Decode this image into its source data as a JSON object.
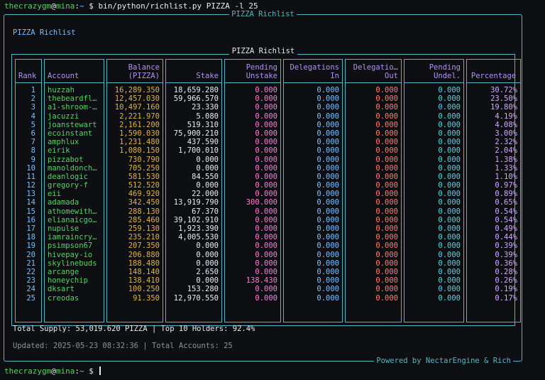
{
  "terminal": {
    "top_prompt": {
      "user": "thecrazygm",
      "host": "mina",
      "path": "~",
      "command": "bin/python/richlist.py PIZZA -l 25"
    },
    "bottom_prompt": {
      "user": "thecrazygm",
      "host": "mina",
      "path": "~"
    }
  },
  "panel": {
    "title": "PIZZA Richlist",
    "heading": "PIZZA Richlist",
    "footer": "Powered by NectarEngine & Rich"
  },
  "table": {
    "title": "PIZZA Richlist",
    "headers": [
      "Rank",
      "Account",
      "Balance\n(PIZZA)",
      "Stake",
      "Pending\nUnstake",
      "Delegations\nIn",
      "Delegatio…\nOut",
      "Pending\nUndel.",
      "Percentage"
    ],
    "rows": [
      [
        "1",
        "huzzah",
        "16,289.350",
        "18,659.280",
        "0.000",
        "0.000",
        "0.000",
        "0.000",
        "30.72%"
      ],
      [
        "2",
        "thebeardfl…",
        "12,457.030",
        "59,966.570",
        "0.000",
        "0.000",
        "0.000",
        "0.000",
        "23.50%"
      ],
      [
        "3",
        "a1-shroom-…",
        "10,497.160",
        "23.330",
        "0.000",
        "0.000",
        "0.000",
        "0.000",
        "19.80%"
      ],
      [
        "4",
        "jacuzzi",
        "2,221.970",
        "5.080",
        "0.000",
        "0.000",
        "0.000",
        "0.000",
        "4.19%"
      ],
      [
        "5",
        "joanstewart",
        "2,161.200",
        "519.310",
        "0.000",
        "0.000",
        "0.000",
        "0.000",
        "4.08%"
      ],
      [
        "6",
        "ecoinstant",
        "1,590.030",
        "75,900.210",
        "0.000",
        "0.000",
        "0.000",
        "0.000",
        "3.00%"
      ],
      [
        "7",
        "amphlux",
        "1,231.480",
        "437.590",
        "0.000",
        "0.000",
        "0.000",
        "0.000",
        "2.32%"
      ],
      [
        "8",
        "eirik",
        "1,080.150",
        "1,700.010",
        "0.000",
        "0.000",
        "0.000",
        "0.000",
        "2.04%"
      ],
      [
        "9",
        "pizzabot",
        "730.790",
        "0.000",
        "0.000",
        "0.000",
        "0.000",
        "0.000",
        "1.38%"
      ],
      [
        "10",
        "manoldonch…",
        "705.250",
        "0.000",
        "0.000",
        "0.000",
        "0.000",
        "0.000",
        "1.33%"
      ],
      [
        "11",
        "deanlogic",
        "581.530",
        "84.550",
        "0.000",
        "0.000",
        "0.000",
        "0.000",
        "1.10%"
      ],
      [
        "12",
        "gregory-f",
        "512.520",
        "0.000",
        "0.000",
        "0.000",
        "0.000",
        "0.000",
        "0.97%"
      ],
      [
        "13",
        "eii",
        "469.920",
        "22.000",
        "0.000",
        "0.000",
        "0.000",
        "0.000",
        "0.89%"
      ],
      [
        "14",
        "adamada",
        "342.450",
        "13,919.790",
        "300.000",
        "0.000",
        "0.000",
        "0.000",
        "0.65%"
      ],
      [
        "15",
        "athomewith…",
        "288.130",
        "67.370",
        "0.000",
        "0.000",
        "0.000",
        "0.000",
        "0.54%"
      ],
      [
        "16",
        "elianaicgo…",
        "285.460",
        "39,102.910",
        "0.000",
        "0.000",
        "0.000",
        "0.000",
        "0.54%"
      ],
      [
        "17",
        "nupulse",
        "259.130",
        "1,923.390",
        "0.000",
        "0.000",
        "0.000",
        "0.000",
        "0.49%"
      ],
      [
        "18",
        "iamraincry…",
        "235.210",
        "4,005.530",
        "0.000",
        "0.000",
        "0.000",
        "0.000",
        "0.44%"
      ],
      [
        "19",
        "psimpson67",
        "207.350",
        "0.000",
        "0.000",
        "0.000",
        "0.000",
        "0.000",
        "0.39%"
      ],
      [
        "20",
        "hivepay-io",
        "206.880",
        "0.000",
        "0.000",
        "0.000",
        "0.000",
        "0.000",
        "0.39%"
      ],
      [
        "21",
        "skylinebuds",
        "188.480",
        "0.000",
        "0.000",
        "0.000",
        "0.000",
        "0.000",
        "0.36%"
      ],
      [
        "22",
        "arcange",
        "148.140",
        "2.650",
        "0.000",
        "0.000",
        "0.000",
        "0.000",
        "0.28%"
      ],
      [
        "23",
        "honeychip",
        "138.410",
        "0.000",
        "138.430",
        "0.000",
        "0.000",
        "0.000",
        "0.26%"
      ],
      [
        "24",
        "dksart",
        "100.250",
        "153.280",
        "0.000",
        "0.000",
        "0.000",
        "0.000",
        "0.19%"
      ],
      [
        "25",
        "creodas",
        "91.350",
        "12,970.550",
        "0.000",
        "0.000",
        "0.000",
        "0.000",
        "0.17%"
      ]
    ]
  },
  "summary": "Total Supply: 53,019.620 PIZZA | Top 10 Holders: 92.4%",
  "updated": "Updated: 2025-05-23 08:32:36 | Total Accounts: 25"
}
